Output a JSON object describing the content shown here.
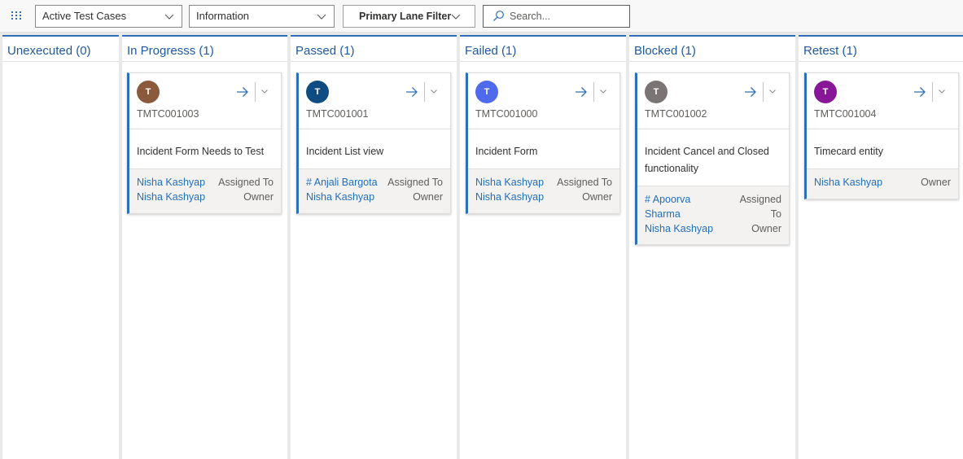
{
  "toolbar": {
    "view_select": "Active Test Cases",
    "form_select": "Information",
    "lane_filter": "Primary Lane Filter",
    "search_placeholder": "Search..."
  },
  "colors": {
    "accent": "#2e6fb7",
    "link": "#1f6fbf"
  },
  "lanes": [
    {
      "title": "Unexecuted (0)"
    },
    {
      "title": "In Progresss (1)"
    },
    {
      "title": "Passed (1)"
    },
    {
      "title": "Failed (1)"
    },
    {
      "title": "Blocked (1)"
    },
    {
      "title": "Retest (1)"
    }
  ],
  "cards": [
    {
      "initial": "T",
      "avatar_color": "#8b5a3c",
      "id": "TMTC001003",
      "title": "Incident Form Needs to Test",
      "assigned_to": "Nisha Kashyap",
      "assigned_label": "Assigned To",
      "owner": "Nisha Kashyap",
      "owner_label": "Owner"
    },
    {
      "initial": "T",
      "avatar_color": "#0f4c81",
      "id": "TMTC001001",
      "title": "Incident List view",
      "assigned_to": "# Anjali Bargota",
      "assigned_label": "Assigned To",
      "owner": "Nisha Kashyap",
      "owner_label": "Owner"
    },
    {
      "initial": "T",
      "avatar_color": "#4f6bed",
      "id": "TMTC001000",
      "title": "Incident Form",
      "assigned_to": "Nisha Kashyap",
      "assigned_label": "Assigned To",
      "owner": "Nisha Kashyap",
      "owner_label": "Owner"
    },
    {
      "initial": "T",
      "avatar_color": "#7a7574",
      "id": "TMTC001002",
      "title": "Incident Cancel and Closed functionality",
      "assigned_to_line1": "# Apoorva",
      "assigned_to_line2": "Sharma",
      "assigned_label_line1": "Assigned",
      "assigned_label_line2": "To",
      "owner": "Nisha Kashyap",
      "owner_label": "Owner"
    },
    {
      "initial": "T",
      "avatar_color": "#881798",
      "id": "TMTC001004",
      "title": "Timecard entity",
      "owner": "Nisha Kashyap",
      "owner_label": "Owner"
    }
  ]
}
